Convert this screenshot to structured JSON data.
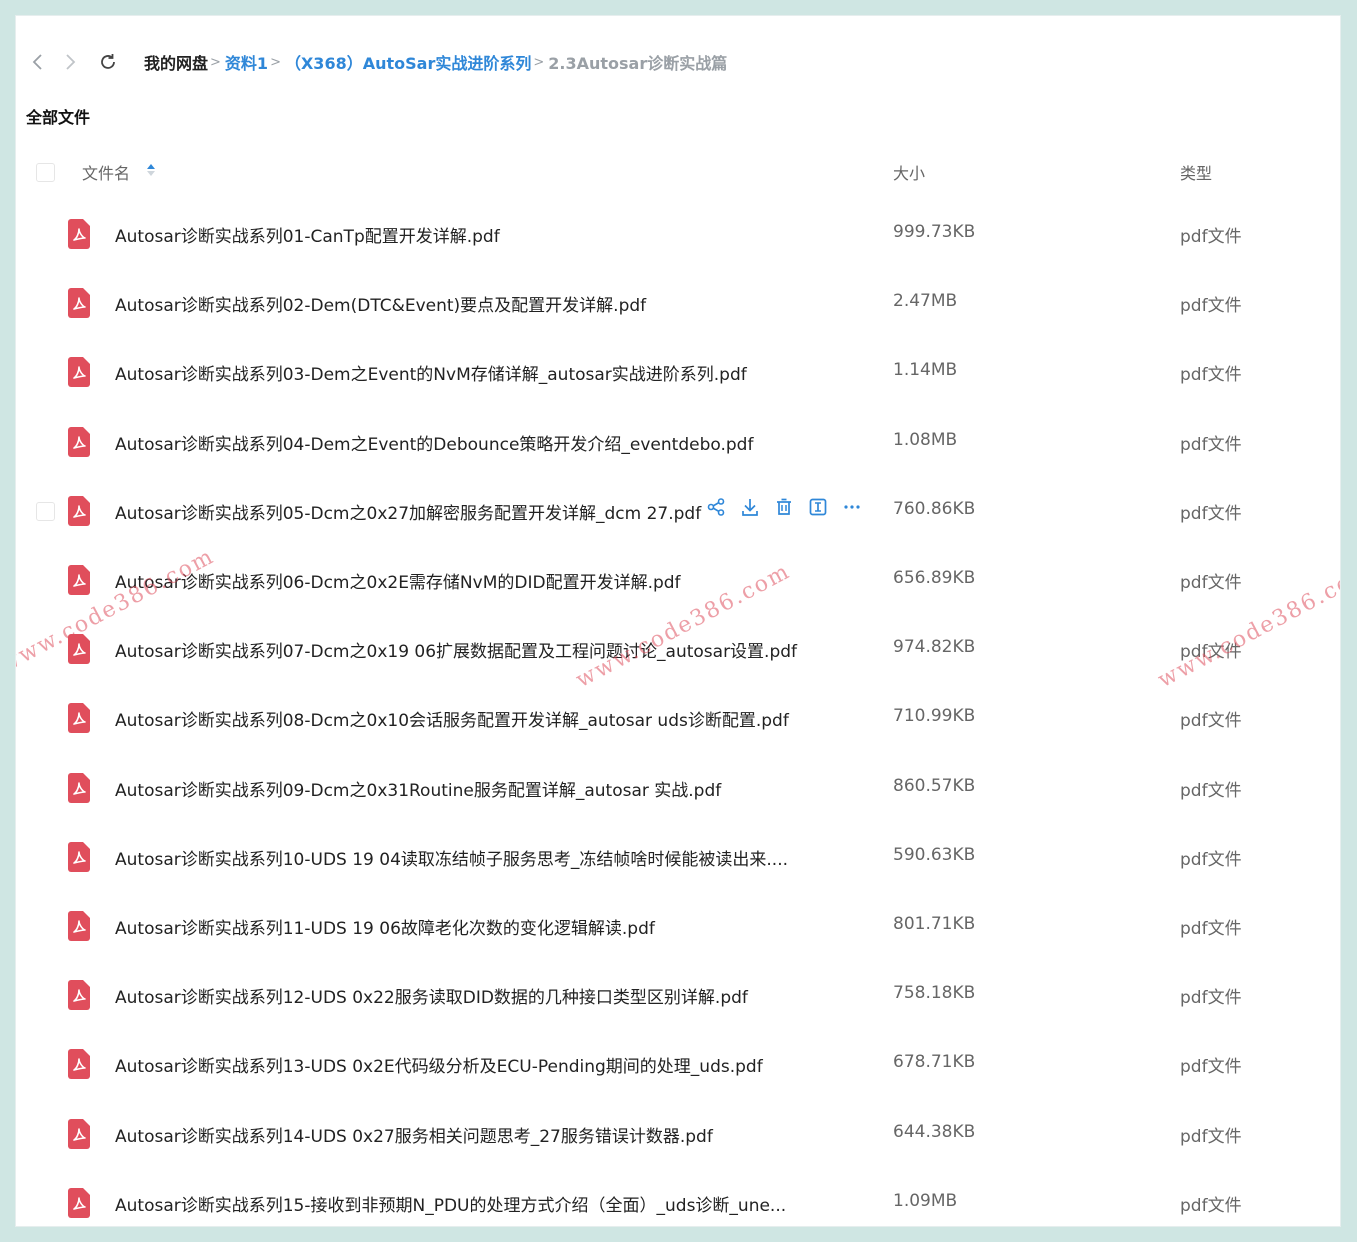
{
  "breadcrumb": {
    "home": "我的网盘",
    "items": [
      "资料1",
      "（X368）AutoSar实战进阶系列"
    ],
    "current": "2.3Autosar诊断实战篇"
  },
  "section_title": "全部文件",
  "columns": {
    "name": "文件名",
    "size": "大小",
    "type": "类型"
  },
  "files": [
    {
      "name": "Autosar诊断实战系列01-CanTp配置开发详解.pdf",
      "size": "999.73KB",
      "type": "pdf文件"
    },
    {
      "name": "Autosar诊断实战系列02-Dem(DTC&Event)要点及配置开发详解.pdf",
      "size": "2.47MB",
      "type": "pdf文件"
    },
    {
      "name": "Autosar诊断实战系列03-Dem之Event的NvM存储详解_autosar实战进阶系列.pdf",
      "size": "1.14MB",
      "type": "pdf文件"
    },
    {
      "name": "Autosar诊断实战系列04-Dem之Event的Debounce策略开发介绍_eventdebo.pdf",
      "size": "1.08MB",
      "type": "pdf文件"
    },
    {
      "name": "Autosar诊断实战系列05-Dcm之0x27加解密服务配置开发详解_dcm 27.pdf",
      "size": "760.86KB",
      "type": "pdf文件"
    },
    {
      "name": "Autosar诊断实战系列06-Dcm之0x2E需存储NvM的DID配置开发详解.pdf",
      "size": "656.89KB",
      "type": "pdf文件"
    },
    {
      "name": "Autosar诊断实战系列07-Dcm之0x19 06扩展数据配置及工程问题讨论_autosar设置.pdf",
      "size": "974.82KB",
      "type": "pdf文件"
    },
    {
      "name": "Autosar诊断实战系列08-Dcm之0x10会话服务配置开发详解_autosar uds诊断配置.pdf",
      "size": "710.99KB",
      "type": "pdf文件"
    },
    {
      "name": "Autosar诊断实战系列09-Dcm之0x31Routine服务配置详解_autosar 实战.pdf",
      "size": "860.57KB",
      "type": "pdf文件"
    },
    {
      "name": "Autosar诊断实战系列10-UDS 19 04读取冻结帧子服务思考_冻结帧啥时候能被读出来....",
      "size": "590.63KB",
      "type": "pdf文件"
    },
    {
      "name": "Autosar诊断实战系列11-UDS 19 06故障老化次数的变化逻辑解读.pdf",
      "size": "801.71KB",
      "type": "pdf文件"
    },
    {
      "name": "Autosar诊断实战系列12-UDS 0x22服务读取DID数据的几种接口类型区别详解.pdf",
      "size": "758.18KB",
      "type": "pdf文件"
    },
    {
      "name": "Autosar诊断实战系列13-UDS 0x2E代码级分析及ECU-Pending期间的处理_uds.pdf",
      "size": "678.71KB",
      "type": "pdf文件"
    },
    {
      "name": "Autosar诊断实战系列14-UDS 0x27服务相关问题思考_27服务错误计数器.pdf",
      "size": "644.38KB",
      "type": "pdf文件"
    },
    {
      "name": "Autosar诊断实战系列15-接收到非预期N_PDU的处理方式介绍（全面）_uds诊断_une...",
      "size": "1.09MB",
      "type": "pdf文件"
    }
  ],
  "row_actions": [
    "share-icon",
    "download-icon",
    "delete-icon",
    "rename-icon",
    "more-icon"
  ],
  "watermark": "www.code386.com",
  "colors": {
    "accent": "#2f87d8",
    "pdf_red": "#e04e5c"
  }
}
